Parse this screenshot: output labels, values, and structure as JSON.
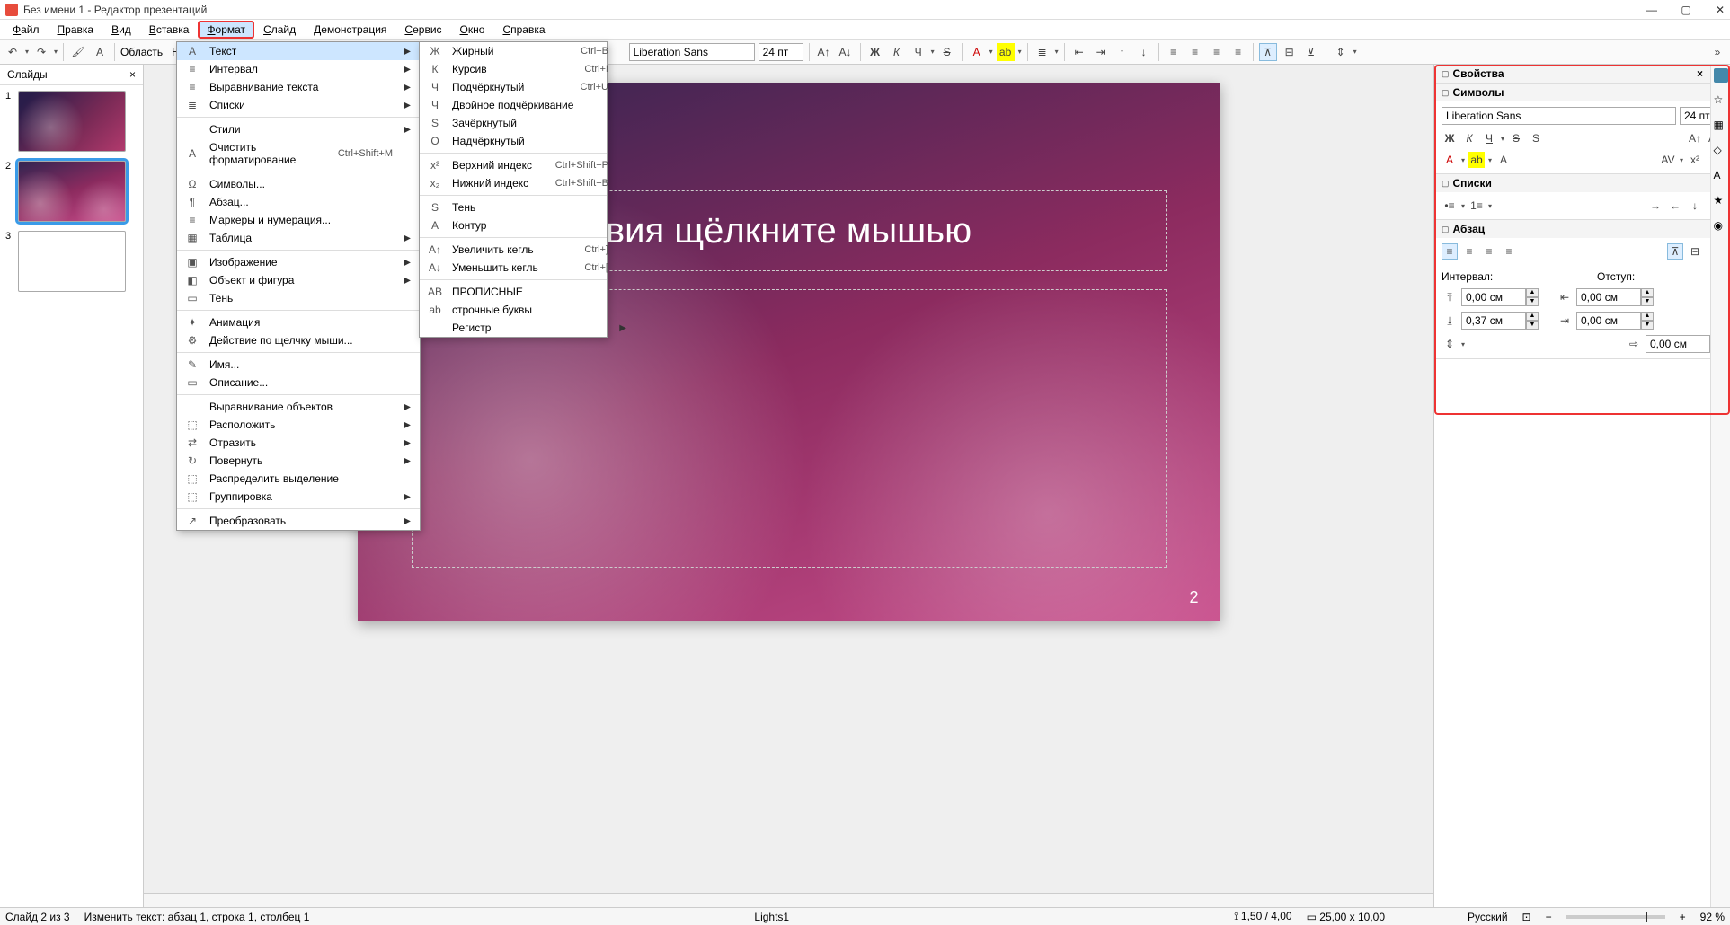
{
  "window": {
    "title": "Без имени 1 - Редактор презентаций"
  },
  "menubar": [
    "Файл",
    "Правка",
    "Вид",
    "Вставка",
    "Формат",
    "Слайд",
    "Демонстрация",
    "Сервис",
    "Окно",
    "Справка"
  ],
  "active_menu_index": 4,
  "toolbar": {
    "layout_label": "Область",
    "no_fill": "Нет",
    "font_name": "Liberation Sans",
    "font_size": "24 пт"
  },
  "slides_panel": {
    "title": "Слайды",
    "items": [
      {
        "num": "1",
        "style": "grad1"
      },
      {
        "num": "2",
        "style": "grad2"
      },
      {
        "num": "3",
        "style": "white"
      }
    ],
    "selected_index": 1
  },
  "slide_content": {
    "title_text": "вия щёлкните мышью",
    "page_number": "2"
  },
  "format_menu": [
    {
      "icon": "A",
      "label": "Текст",
      "arrow": true,
      "hover": true
    },
    {
      "icon": "≡",
      "label": "Интервал",
      "arrow": true
    },
    {
      "icon": "≡",
      "label": "Выравнивание текста",
      "arrow": true
    },
    {
      "icon": "≣",
      "label": "Списки",
      "arrow": true
    },
    {
      "sep": true
    },
    {
      "icon": "",
      "label": "Стили",
      "arrow": true
    },
    {
      "icon": "A",
      "label": "Очистить форматирование",
      "shortcut": "Ctrl+Shift+M"
    },
    {
      "sep": true
    },
    {
      "icon": "Ω",
      "label": "Символы..."
    },
    {
      "icon": "¶",
      "label": "Абзац..."
    },
    {
      "icon": "≡",
      "label": "Маркеры и нумерация..."
    },
    {
      "icon": "▦",
      "label": "Таблица",
      "arrow": true
    },
    {
      "sep": true
    },
    {
      "icon": "▣",
      "label": "Изображение",
      "arrow": true
    },
    {
      "icon": "◧",
      "label": "Объект и фигура",
      "arrow": true
    },
    {
      "icon": "▭",
      "label": "Тень"
    },
    {
      "sep": true
    },
    {
      "icon": "✦",
      "label": "Анимация"
    },
    {
      "icon": "⚙",
      "label": "Действие по щелчку мыши..."
    },
    {
      "sep": true
    },
    {
      "icon": "✎",
      "label": "Имя..."
    },
    {
      "icon": "▭",
      "label": "Описание..."
    },
    {
      "sep": true
    },
    {
      "icon": "",
      "label": "Выравнивание объектов",
      "arrow": true
    },
    {
      "icon": "⬚",
      "label": "Расположить",
      "arrow": true
    },
    {
      "icon": "⇄",
      "label": "Отразить",
      "arrow": true
    },
    {
      "icon": "↻",
      "label": "Повернуть",
      "arrow": true
    },
    {
      "icon": "⬚",
      "label": "Распределить выделение"
    },
    {
      "icon": "⬚",
      "label": "Группировка",
      "arrow": true
    },
    {
      "sep": true
    },
    {
      "icon": "↗",
      "label": "Преобразовать",
      "arrow": true
    }
  ],
  "text_submenu": [
    {
      "icon": "Ж",
      "label": "Жирный",
      "shortcut": "Ctrl+B"
    },
    {
      "icon": "К",
      "label": "Курсив",
      "shortcut": "Ctrl+I"
    },
    {
      "icon": "Ч",
      "label": "Подчёркнутый",
      "shortcut": "Ctrl+U"
    },
    {
      "icon": "Ч",
      "label": "Двойное подчёркивание"
    },
    {
      "icon": "S",
      "label": "Зачёркнутый"
    },
    {
      "icon": "O",
      "label": "Надчёркнутый"
    },
    {
      "sep": true
    },
    {
      "icon": "x²",
      "label": "Верхний индекс",
      "shortcut": "Ctrl+Shift+P"
    },
    {
      "icon": "x₂",
      "label": "Нижний индекс",
      "shortcut": "Ctrl+Shift+B"
    },
    {
      "sep": true
    },
    {
      "icon": "S",
      "label": "Тень"
    },
    {
      "icon": "A",
      "label": "Контур"
    },
    {
      "sep": true
    },
    {
      "icon": "A↑",
      "label": "Увеличить кегль",
      "shortcut": "Ctrl+]"
    },
    {
      "icon": "A↓",
      "label": "Уменьшить кегль",
      "shortcut": "Ctrl+["
    },
    {
      "sep": true
    },
    {
      "icon": "AB",
      "label": "ПРОПИСНЫЕ"
    },
    {
      "icon": "ab",
      "label": "строчные буквы"
    },
    {
      "icon": "",
      "label": "Регистр",
      "arrow": true
    }
  ],
  "props": {
    "title": "Свойства",
    "symbols": {
      "title": "Символы",
      "font_name": "Liberation Sans",
      "font_size": "24 пт"
    },
    "lists": {
      "title": "Списки"
    },
    "paragraph": {
      "title": "Абзац",
      "interval_label": "Интервал:",
      "indent_label": "Отступ:",
      "sp_before": "0,00 см",
      "sp_after": "0,37 см",
      "ind_before": "0,00 см",
      "ind_after": "0,00 см",
      "ind_first": "0,00 см"
    }
  },
  "statusbar": {
    "slide_pos": "Слайд 2 из 3",
    "edit_info": "Изменить текст: абзац 1, строка 1, столбец 1",
    "template": "Lights1",
    "cursor": "1,50 / 4,00",
    "size": "25,00 x 10,00",
    "lang": "Русский",
    "zoom": "92 %"
  }
}
